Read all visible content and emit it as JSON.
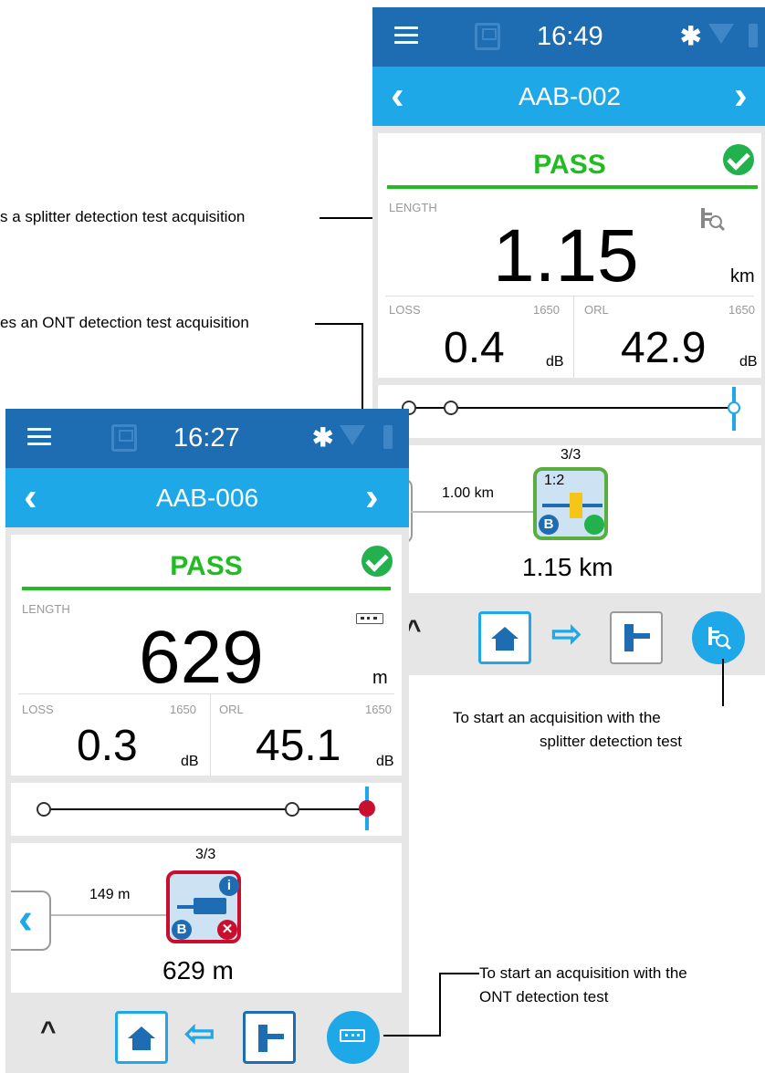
{
  "callouts": {
    "splitter_result": "s a splitter detection test acquisition",
    "ont_result": "es an ONT detection test acquisition",
    "splitter_start_line1": "To start an acquisition with the",
    "splitter_start_line2": "splitter detection test",
    "ont_start_line1": "To start an acquisition with the",
    "ont_start_line2": "ONT detection test"
  },
  "screen_splitter": {
    "time": "16:49",
    "title": "AAB-002",
    "status": "PASS",
    "length_label": "LENGTH",
    "length_value": "1.15",
    "length_unit": "km",
    "loss_label": "LOSS",
    "loss_wavelength": "1650",
    "loss_value": "0.4",
    "loss_unit": "dB",
    "orl_label": "ORL",
    "orl_wavelength": "1650",
    "orl_value": "42.9",
    "orl_unit": "dB",
    "element_index": "3/3",
    "span_distance": "1.00 km",
    "element_ratio": "1:2",
    "element_badge": "B",
    "element_position": "1.15 km"
  },
  "screen_ont": {
    "time": "16:27",
    "title": "AAB-006",
    "status": "PASS",
    "length_label": "LENGTH",
    "length_value": "629",
    "length_unit": "m",
    "loss_label": "LOSS",
    "loss_wavelength": "1650",
    "loss_value": "0.3",
    "loss_unit": "dB",
    "orl_label": "ORL",
    "orl_wavelength": "1650",
    "orl_value": "45.1",
    "orl_unit": "dB",
    "element_index": "3/3",
    "span_distance": "149 m",
    "element_badge": "B",
    "element_position": "629 m"
  },
  "colors": {
    "status_bar": "#1e6db3",
    "nav_bar": "#1ea8e8",
    "pass_green": "#22bb22",
    "fail_red": "#c8102e"
  },
  "icons": [
    "menu-icon",
    "save-icon",
    "bluetooth-icon",
    "wifi-icon",
    "battery-icon",
    "chevron-left-icon",
    "chevron-right-icon",
    "check-icon",
    "splitter-detect-icon",
    "ont-detect-icon",
    "home-icon",
    "arrow-right-icon",
    "arrow-left-icon",
    "element-icon",
    "caret-up-icon"
  ]
}
